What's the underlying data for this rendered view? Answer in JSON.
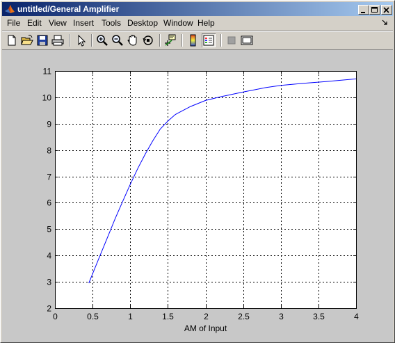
{
  "window": {
    "title": "untitled/General Amplifier",
    "icon": "matlab-logo-icon"
  },
  "menu": {
    "items": [
      "File",
      "Edit",
      "View",
      "Insert",
      "Tools",
      "Desktop",
      "Window",
      "Help"
    ]
  },
  "toolbar": {
    "icons": [
      "new-figure-icon",
      "open-file-icon",
      "save-icon",
      "print-icon",
      "edit-plot-arrow-icon",
      "zoom-in-icon",
      "zoom-out-icon",
      "pan-hand-icon",
      "rotate-3d-icon",
      "data-cursor-icon",
      "colorbar-icon",
      "legend-icon",
      "hide-plot-tools-icon",
      "show-plot-tools-icon"
    ]
  },
  "colors": {
    "titlebar_start": "#0a246a",
    "titlebar_end": "#a6caf0",
    "line": "#0000ff",
    "figure_bg": "#c8c8c8"
  },
  "chart_data": {
    "type": "line",
    "title": "",
    "xlabel": "AM of Input",
    "ylabel": "",
    "xlim": [
      0,
      4
    ],
    "ylim": [
      2,
      11
    ],
    "xticks": [
      0,
      0.5,
      1,
      1.5,
      2,
      2.5,
      3,
      3.5,
      4
    ],
    "xtick_labels": [
      "0",
      "0.5",
      "1",
      "1.5",
      "2",
      "2.5",
      "3",
      "3.5",
      "4"
    ],
    "yticks": [
      2,
      3,
      4,
      5,
      6,
      7,
      8,
      9,
      10,
      11
    ],
    "ytick_labels": [
      "2",
      "3",
      "4",
      "5",
      "6",
      "7",
      "8",
      "9",
      "10",
      "11"
    ],
    "grid": true,
    "grid_style": "dashed",
    "series": [
      {
        "color": "#0000ff",
        "x": [
          0.45,
          0.5,
          0.6,
          0.7,
          0.8,
          0.9,
          1.0,
          1.1,
          1.2,
          1.3,
          1.4,
          1.5,
          1.6,
          1.8,
          2.0,
          2.2,
          2.5,
          2.8,
          3.0,
          3.3,
          3.6,
          4.0
        ],
        "y": [
          2.95,
          3.3,
          4.0,
          4.7,
          5.4,
          6.05,
          6.7,
          7.3,
          7.85,
          8.35,
          8.8,
          9.1,
          9.35,
          9.65,
          9.88,
          10.02,
          10.2,
          10.37,
          10.45,
          10.53,
          10.6,
          10.7
        ]
      }
    ]
  }
}
